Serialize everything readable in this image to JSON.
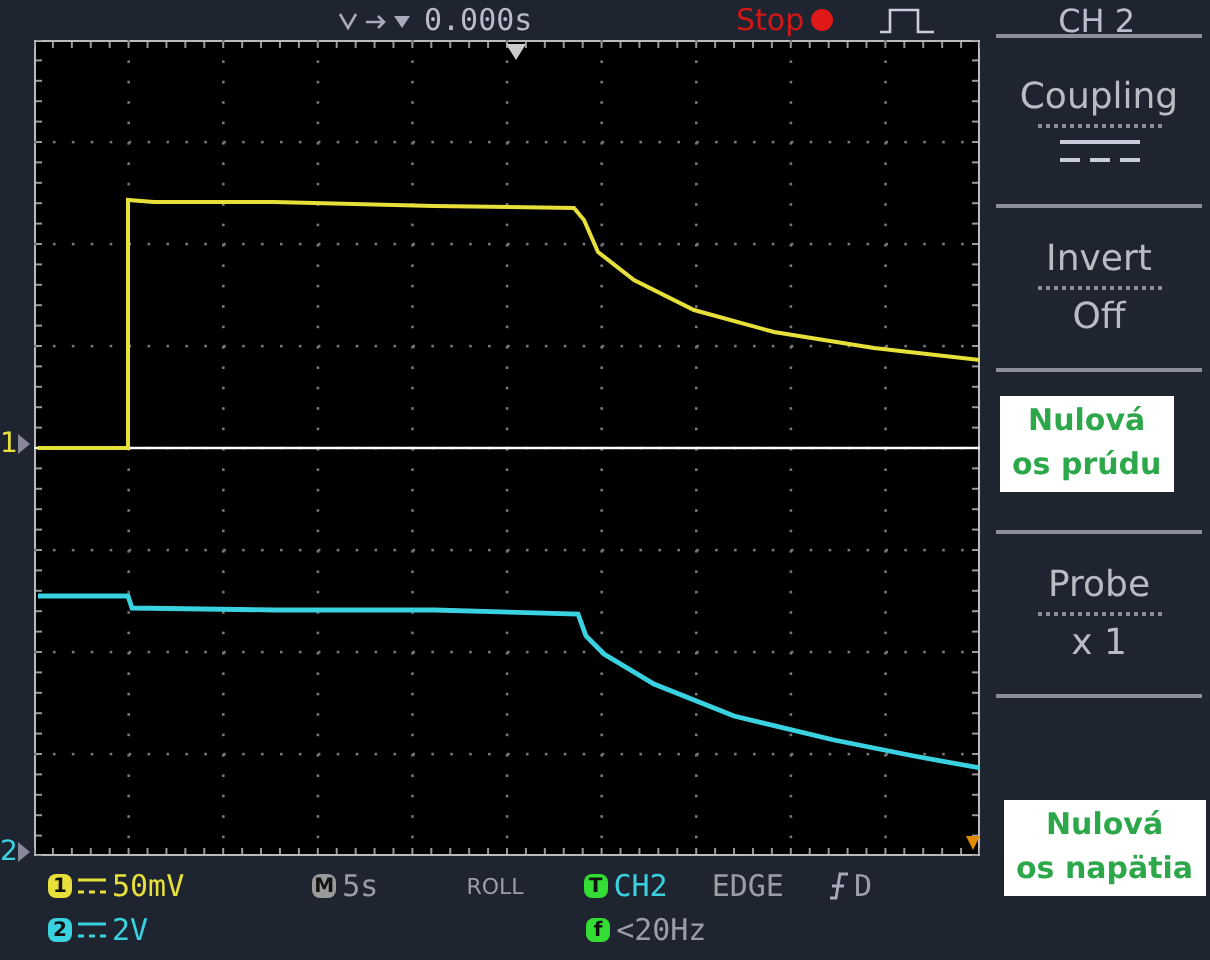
{
  "top_bar": {
    "trigger_position": "0.000s",
    "run_state": "Stop",
    "channel_title": "CH 2"
  },
  "menu": [
    {
      "kind": "icon",
      "label": "Coupling"
    },
    {
      "kind": "text",
      "label": "Invert",
      "value": "Off"
    },
    {
      "kind": "blank"
    },
    {
      "kind": "text",
      "label": "Probe",
      "value": "x 1"
    },
    {
      "kind": "blank"
    }
  ],
  "markers": [
    {
      "label": "1",
      "color": "#e8e03a"
    },
    {
      "label": "2",
      "color": "#3ad2e0"
    }
  ],
  "annotations": [
    {
      "lines": [
        "Nulová",
        "os prúdu"
      ]
    },
    {
      "lines": [
        "Nulová",
        "os napätia"
      ]
    }
  ],
  "status": {
    "channels": [
      {
        "badge": "1",
        "scale": "50mV",
        "color": "#e8e03a"
      },
      {
        "badge": "2",
        "scale": "2V",
        "color": "#3ad2e0"
      }
    ],
    "timebase": {
      "badge": "M",
      "value": "5s"
    },
    "mode": "ROLL",
    "trigger": {
      "badge": "T",
      "source": "CH2",
      "type": "EDGE",
      "slope_tail": "D"
    },
    "filter": {
      "badge": "f",
      "value": "<20Hz"
    }
  }
}
